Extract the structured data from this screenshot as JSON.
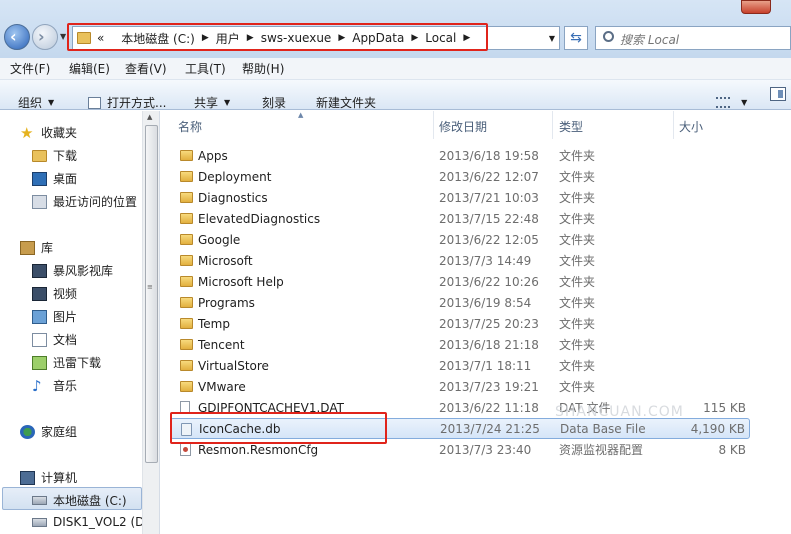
{
  "address": {
    "crumbs": [
      "本地磁盘 (C:)",
      "用户",
      "sws-xuexue",
      "AppData",
      "Local"
    ],
    "overflow": "«"
  },
  "search": {
    "placeholder": "搜索 Local"
  },
  "menu": [
    "文件(F)",
    "编辑(E)",
    "查看(V)",
    "工具(T)",
    "帮助(H)"
  ],
  "toolbar": {
    "organize": "组织",
    "open_with": "打开方式...",
    "share": "共享",
    "burn": "刻录",
    "new_folder": "新建文件夹"
  },
  "nav": {
    "favorites": "收藏夹",
    "downloads": "下载",
    "desktop": "桌面",
    "recent": "最近访问的位置",
    "libraries": "库",
    "storm": "暴风影视库",
    "videos": "视频",
    "pictures": "图片",
    "documents": "文档",
    "thunder": "迅雷下载",
    "music": "音乐",
    "homegroup": "家庭组",
    "computer": "计算机",
    "local_disk": "本地磁盘 (C:)",
    "disk1": "DISK1_VOL2 (D"
  },
  "columns": {
    "name": "名称",
    "date": "修改日期",
    "type": "类型",
    "size": "大小"
  },
  "files": [
    {
      "name": "Apps",
      "date": "2013/6/18 19:58",
      "type": "文件夹",
      "size": "",
      "kind": "folder"
    },
    {
      "name": "Deployment",
      "date": "2013/6/22 12:07",
      "type": "文件夹",
      "size": "",
      "kind": "folder"
    },
    {
      "name": "Diagnostics",
      "date": "2013/7/21 10:03",
      "type": "文件夹",
      "size": "",
      "kind": "folder"
    },
    {
      "name": "ElevatedDiagnostics",
      "date": "2013/7/15 22:48",
      "type": "文件夹",
      "size": "",
      "kind": "folder"
    },
    {
      "name": "Google",
      "date": "2013/6/22 12:05",
      "type": "文件夹",
      "size": "",
      "kind": "folder"
    },
    {
      "name": "Microsoft",
      "date": "2013/7/3 14:49",
      "type": "文件夹",
      "size": "",
      "kind": "folder"
    },
    {
      "name": "Microsoft Help",
      "date": "2013/6/22 10:26",
      "type": "文件夹",
      "size": "",
      "kind": "folder"
    },
    {
      "name": "Programs",
      "date": "2013/6/19 8:54",
      "type": "文件夹",
      "size": "",
      "kind": "folder"
    },
    {
      "name": "Temp",
      "date": "2013/7/25 20:23",
      "type": "文件夹",
      "size": "",
      "kind": "folder"
    },
    {
      "name": "Tencent",
      "date": "2013/6/18 21:18",
      "type": "文件夹",
      "size": "",
      "kind": "folder"
    },
    {
      "name": "VirtualStore",
      "date": "2013/7/1 18:11",
      "type": "文件夹",
      "size": "",
      "kind": "folder"
    },
    {
      "name": "VMware",
      "date": "2013/7/23 19:21",
      "type": "文件夹",
      "size": "",
      "kind": "folder"
    },
    {
      "name": "GDIPFONTCACHEV1.DAT",
      "date": "2013/6/22 11:18",
      "type": "DAT 文件",
      "size": "115 KB",
      "kind": "file"
    },
    {
      "name": "IconCache.db",
      "date": "2013/7/24 21:25",
      "type": "Data Base File",
      "size": "4,190 KB",
      "kind": "db"
    },
    {
      "name": "Resmon.ResmonCfg",
      "date": "2013/7/3 23:40",
      "type": "资源监视器配置",
      "size": "8 KB",
      "kind": "msc"
    }
  ],
  "selected_file": "IconCache.db",
  "watermark": "SHANCUAN.COM"
}
